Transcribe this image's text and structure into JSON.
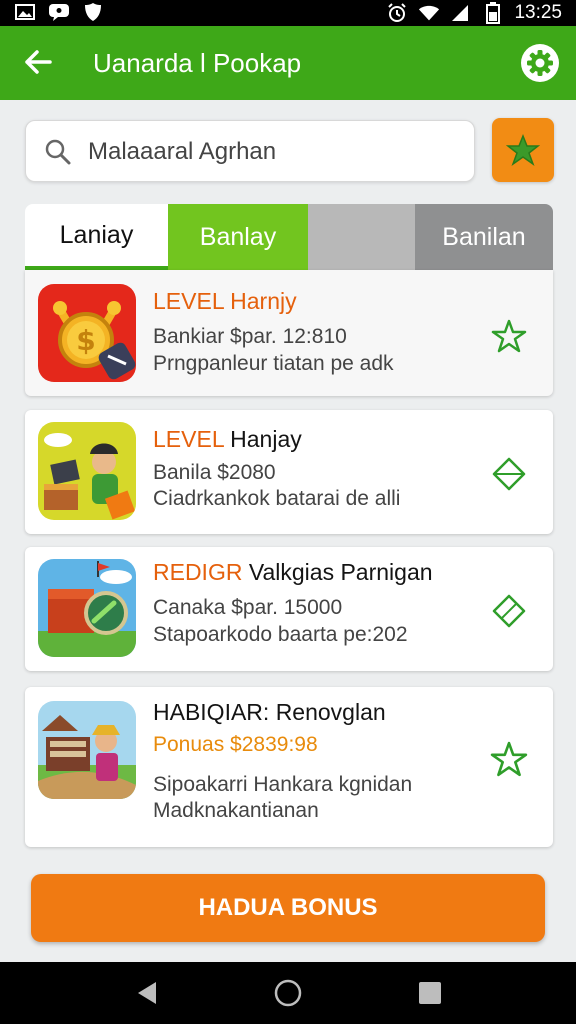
{
  "status_bar": {
    "time": "13:25"
  },
  "app_bar": {
    "title": "Uanarda l Pookap"
  },
  "search": {
    "value": "Malaaaral Agrhan",
    "placeholder": ""
  },
  "tabs": [
    {
      "label": "Laniay"
    },
    {
      "label": "Banlay"
    },
    {
      "label": ""
    },
    {
      "label": "Banilan"
    }
  ],
  "cards": [
    {
      "title_highlight": "LEVEL Harnjy",
      "title_rest": "",
      "line1": "Bankiar $par. 12:810",
      "line2": "Prngpanleur tiatan pe adk",
      "action_icon": "star-outline-icon"
    },
    {
      "title_highlight": "LEVEL",
      "title_rest": " Hanjay",
      "line1": "Banila $2080",
      "line2": "Ciadrkankok batarai de alli",
      "action_icon": "diamond-outline-icon"
    },
    {
      "title_highlight": "REDIGR",
      "title_rest": " Valkgias Parnigan",
      "line1": "Canaka $par. 15000",
      "line2": "Stapoarkodo baarta pe:202",
      "action_icon": "diamond-outline-icon"
    },
    {
      "title_highlight": "",
      "title_rest": "HABIQIAR: Renovglan",
      "line1": "Ponuas $2839:98",
      "line2": "Sipoakarri Hankara kgnidan",
      "line3": "Madknakantianan",
      "action_icon": "star-outline-icon"
    }
  ],
  "bonus_button": {
    "label": "HADUA BONUS"
  },
  "colors": {
    "primary_green": "#3ea818",
    "accent_orange": "#f07a12",
    "highlight_orange": "#e5600c"
  }
}
